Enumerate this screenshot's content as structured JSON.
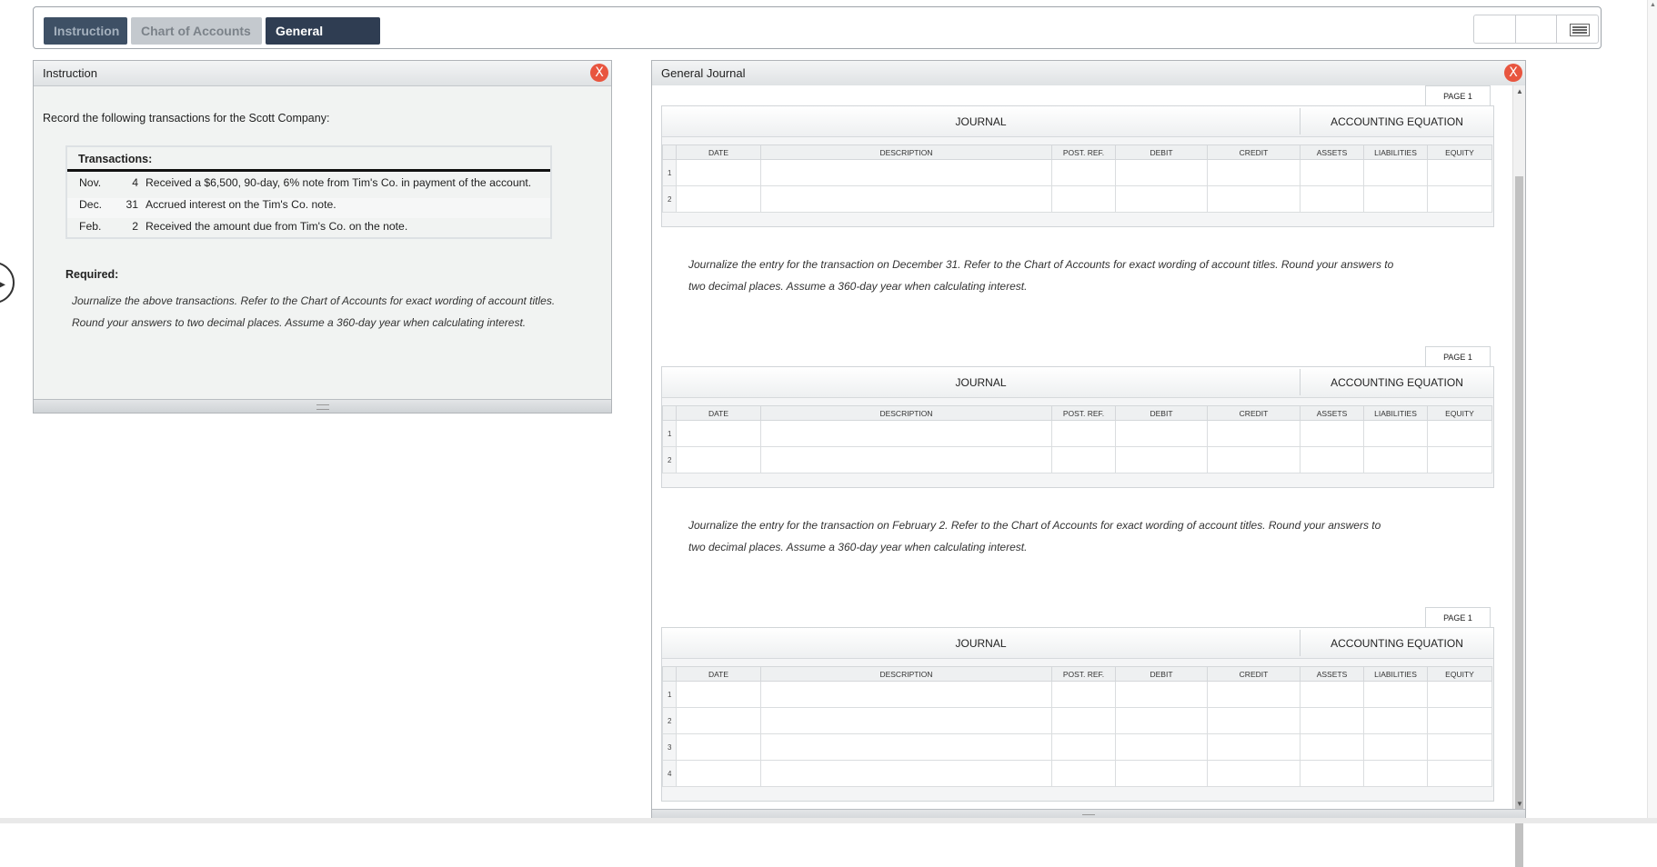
{
  "tabs": {
    "instruction": "Instruction",
    "chart_of_accounts": "Chart of Accounts",
    "general_journal": "General Journal"
  },
  "toolbar": {
    "menu_icon": "hamburger-menu-icon"
  },
  "instruction_panel": {
    "title": "Instruction",
    "close": "X",
    "intro": "Record the following transactions for the Scott Company:",
    "transactions_title": "Transactions:",
    "transactions": [
      {
        "month": "Nov.",
        "day": "4",
        "text": "Received a $6,500, 90-day, 6% note from Tim's Co. in payment of the account."
      },
      {
        "month": "Dec.",
        "day": "31",
        "text": "Accrued interest on the Tim's Co. note."
      },
      {
        "month": "Feb.",
        "day": "2",
        "text": "Received the amount due from Tim's Co. on the note."
      }
    ],
    "required_title": "Required:",
    "required_text": "Journalize the above transactions. Refer to the Chart of Accounts for exact wording of account titles. Round your answers to two decimal places. Assume a 360-day year when calculating interest."
  },
  "journal_panel": {
    "title": "General Journal",
    "close": "X",
    "columns": {
      "date": "DATE",
      "description": "DESCRIPTION",
      "post_ref": "POST. REF.",
      "debit": "DEBIT",
      "credit": "CREDIT",
      "assets": "ASSETS",
      "liabilities": "LIABILITIES",
      "equity": "EQUITY"
    },
    "journal_label": "JOURNAL",
    "equation_label": "ACCOUNTING EQUATION",
    "journals": [
      {
        "page": "PAGE 1",
        "rows": [
          "1",
          "2"
        ]
      },
      {
        "page": "PAGE 1",
        "rows": [
          "1",
          "2"
        ]
      },
      {
        "page": "PAGE 1",
        "rows": [
          "1",
          "2",
          "3",
          "4"
        ]
      }
    ],
    "prompts": [
      "Journalize the entry for the transaction on December 31. Refer to the Chart of Accounts for exact wording of account titles. Round your answers to two decimal places. Assume a 360-day year when calculating interest.",
      "Journalize the entry for the transaction on February 2. Refer to the Chart of Accounts for exact wording of account titles. Round your answers to two decimal places. Assume a 360-day year when calculating interest."
    ]
  }
}
